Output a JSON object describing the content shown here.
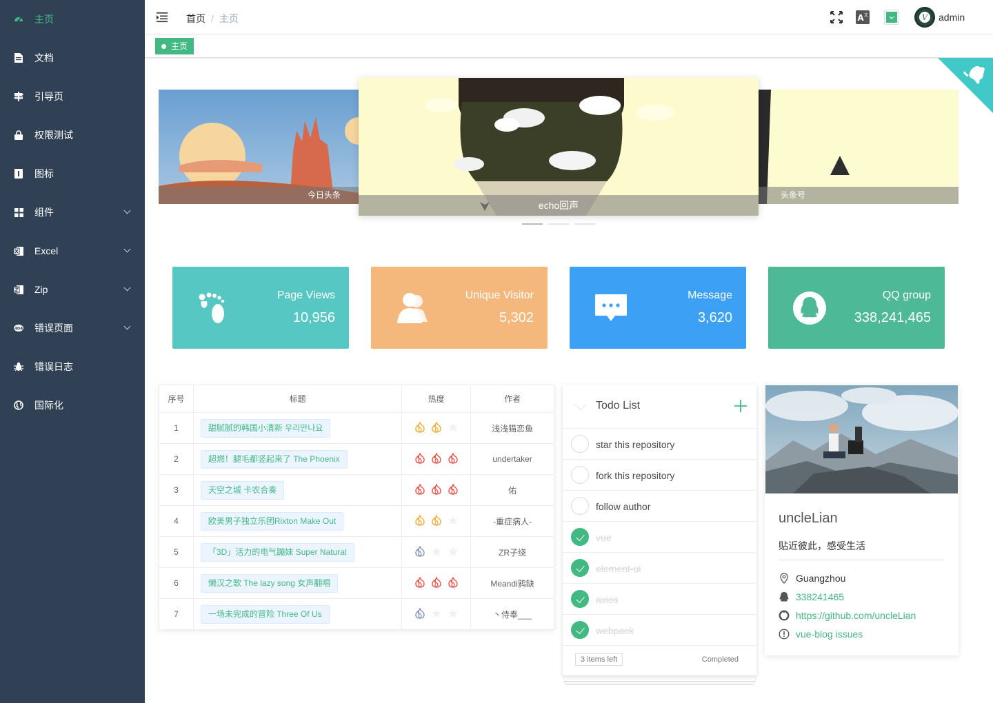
{
  "sidebar": {
    "items": [
      {
        "label": "主页",
        "icon": "dashboard-icon",
        "active": true
      },
      {
        "label": "文档",
        "icon": "document-icon"
      },
      {
        "label": "引导页",
        "icon": "guide-icon"
      },
      {
        "label": "权限测试",
        "icon": "lock-icon"
      },
      {
        "label": "图标",
        "icon": "icon-icon"
      },
      {
        "label": "组件",
        "icon": "component-icon",
        "submenu": true
      },
      {
        "label": "Excel",
        "icon": "excel-icon",
        "submenu": true
      },
      {
        "label": "Zip",
        "icon": "zip-icon",
        "submenu": true
      },
      {
        "label": "错误页面",
        "icon": "404-icon",
        "submenu": true
      },
      {
        "label": "错误日志",
        "icon": "bug-icon"
      },
      {
        "label": "国际化",
        "icon": "international-icon"
      }
    ]
  },
  "navbar": {
    "breadcrumb": [
      "首页",
      "主页"
    ],
    "separator": "/",
    "username": "admin",
    "avatar_letter": "V"
  },
  "tags": {
    "active": "主页"
  },
  "carousel": {
    "left_caption": "今日头条",
    "center_caption": "echo回声",
    "right_caption": "头条号"
  },
  "cards": [
    {
      "title": "Page Views",
      "value": "10,956",
      "color": "#57c7c3",
      "icon": "footprint-icon"
    },
    {
      "title": "Unique Visitor",
      "value": "5,302",
      "color": "#f4b77c",
      "icon": "people-icon"
    },
    {
      "title": "Message",
      "value": "3,620",
      "color": "#3ca1f4",
      "icon": "message-icon"
    },
    {
      "title": "QQ group",
      "value": "338,241,465",
      "color": "#4db996",
      "icon": "qq-icon"
    }
  ],
  "table": {
    "headers": [
      "序号",
      "标题",
      "热度",
      "作者"
    ],
    "rows": [
      {
        "no": "1",
        "title": "甜腻腻的韩国小清新 우리만나요",
        "heat": 2,
        "heat_color": "#f5a623",
        "author": "浅浅猫恋鱼"
      },
      {
        "no": "2",
        "title": "超燃！腿毛都竖起来了 The Phoenix",
        "heat": 3,
        "heat_color": "#f0463a",
        "author": "undertaker"
      },
      {
        "no": "3",
        "title": "天空之城 卡农合奏",
        "heat": 3,
        "heat_color": "#f0463a",
        "author": "佑"
      },
      {
        "no": "4",
        "title": "欧美男子独立乐团Rixton Make Out",
        "heat": 2,
        "heat_color": "#f5a623",
        "author": "-重症病人-"
      },
      {
        "no": "5",
        "title": "「3D」活力的电气蹦妹 Super Natural",
        "heat": 1,
        "heat_color": "#7d8fb3",
        "author": "ZR子绕"
      },
      {
        "no": "6",
        "title": "懒汉之歌 The lazy song 女声翻唱",
        "heat": 3,
        "heat_color": "#f0463a",
        "author": "Meandi鸦缺"
      },
      {
        "no": "7",
        "title": "一场未完成的冒险 Three Of Us",
        "heat": 1,
        "heat_color": "#7d8fb3",
        "author": "丶侍奉___"
      }
    ]
  },
  "todo": {
    "title": "Todo List",
    "items": [
      {
        "text": "star this repository",
        "done": false
      },
      {
        "text": "fork this repository",
        "done": false
      },
      {
        "text": "follow author",
        "done": false
      },
      {
        "text": "vue",
        "done": true
      },
      {
        "text": "element-ui",
        "done": true
      },
      {
        "text": "axios",
        "done": true
      },
      {
        "text": "webpack",
        "done": true
      }
    ],
    "left_count": "3 items left",
    "filter": "Completed"
  },
  "profile": {
    "name": "uncleLian",
    "bio": "贴近彼此，感受生活",
    "location": "Guangzhou",
    "qq": "338241465",
    "github": "https://github.com/uncleLian",
    "issues": "vue-blog issues"
  },
  "colors": {
    "sidebar_bg": "#304156",
    "accent": "#42b983"
  }
}
